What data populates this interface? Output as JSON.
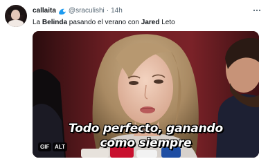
{
  "tweet": {
    "display_name": "callaita",
    "handle": "@sraculishi",
    "separator": "·",
    "timestamp": "14h",
    "verified_icon": "wave-icon",
    "more_icon": "more-horizontal-icon",
    "text_parts": {
      "p1": "La ",
      "p2": "Belinda",
      "p3": " pasando el verano con ",
      "p4": "Jared",
      "p5": " Leto"
    },
    "media": {
      "caption_line1": "Todo perfecto, ganando",
      "caption_line2": "como siempre",
      "gif_badge": "GIF",
      "alt_badge": "ALT"
    }
  },
  "colors": {
    "primary_text": "#0f1419",
    "secondary_text": "#536471",
    "wave_icon": "#1d9bf0"
  }
}
